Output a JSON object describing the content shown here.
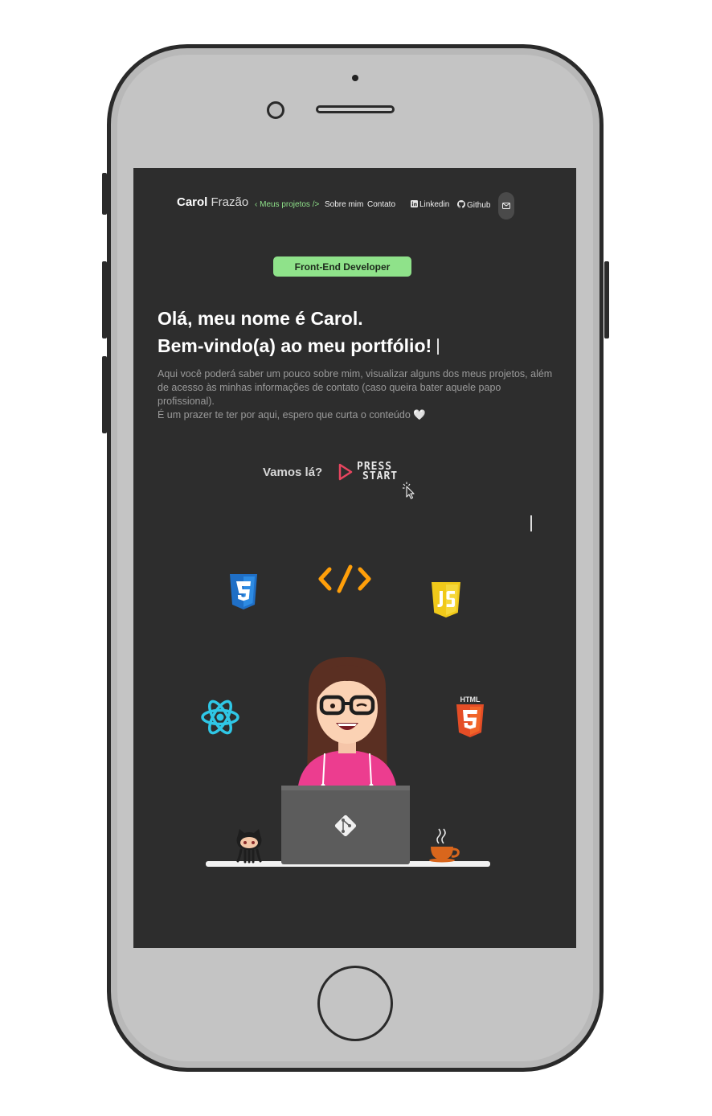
{
  "nav": {
    "brand_first": "Carol",
    "brand_last": "Frazão",
    "links": [
      "‹ Meus projetos />",
      "Sobre mim",
      "Contato"
    ],
    "social": [
      "Linkedin",
      "Github"
    ]
  },
  "hero": {
    "badge": "Front-End Developer",
    "title_line1": "Olá, meu nome é Carol.",
    "title_line2": "Bem-vindo(a) ao meu portfólio!",
    "desc_line1": "Aqui você poderá saber um pouco sobre mim, visualizar alguns dos meus projetos, além de acesso às minhas informações de contato (caso queira bater aquele papo profissional).",
    "desc_line2": "É um prazer te ter por aqui, espero que curta o conteúdo 🤍",
    "cta_text": "Vamos lá?",
    "press_line1": "PRESS",
    "press_line2": "START"
  },
  "illustration": {
    "icons": [
      "css3-icon",
      "code-icon",
      "javascript-icon",
      "react-icon",
      "html5-icon",
      "github-octocat-icon",
      "git-icon",
      "coffee-cup-icon"
    ],
    "accent": "#8fe28a",
    "hoodie": "#ec3d8f"
  }
}
